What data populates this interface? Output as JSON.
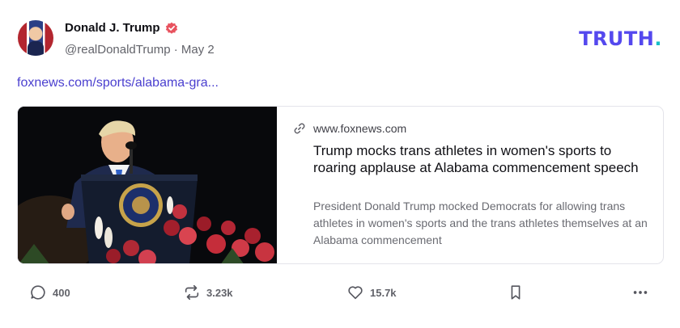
{
  "author": {
    "name": "Donald J. Trump",
    "handle": "@realDonaldTrump",
    "separator": "·",
    "date": "May 2",
    "verified": true,
    "verified_color": "#e8535f"
  },
  "brand": {
    "logo_text": "TRUTH",
    "logo_dot": ".",
    "logo_color": "#5448ee",
    "dot_color": "#17bfc7"
  },
  "post": {
    "link_text": "foxnews.com/sports/alabama-gra..."
  },
  "link_card": {
    "domain": "www.foxnews.com",
    "title": "Trump mocks trans athletes in women's sports to roaring applause at Alabama commencement speech",
    "description": "President Donald Trump mocked Democrats for allowing trans athletes in women's sports and the trans athletes themselves at an Alabama commencement",
    "image_alt": "photo-speaker-at-podium"
  },
  "actions": {
    "reply_count": "400",
    "retruth_count": "3.23k",
    "like_count": "15.7k",
    "icons": [
      "comment-icon",
      "retruth-icon",
      "heart-icon",
      "bookmark-icon",
      "more-icon"
    ]
  }
}
